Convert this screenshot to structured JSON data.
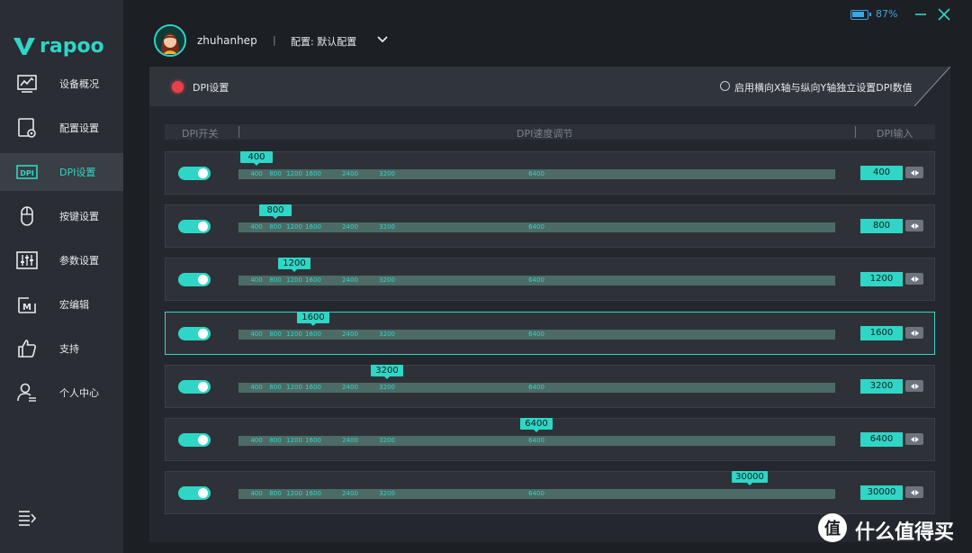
{
  "brand": {
    "logo_text": "rapoo",
    "logo_color": "#2fd6c6"
  },
  "sidebar": {
    "items": [
      {
        "label": "设备概况",
        "icon": "monitor-chart-icon",
        "active": false
      },
      {
        "label": "配置设置",
        "icon": "config-settings-icon",
        "active": false
      },
      {
        "label": "DPI设置",
        "icon": "dpi-icon",
        "active": true
      },
      {
        "label": "按键设置",
        "icon": "mouse-icon",
        "active": false
      },
      {
        "label": "参数设置",
        "icon": "sliders-icon",
        "active": false
      },
      {
        "label": "宏编辑",
        "icon": "macro-icon",
        "active": false
      },
      {
        "label": "支持",
        "icon": "thumbs-up-icon",
        "active": false
      },
      {
        "label": "个人中心",
        "icon": "user-icon",
        "active": false
      }
    ]
  },
  "topbar": {
    "username": "zhuhanhep",
    "separator": "|",
    "config_label": "配置: 默认配置",
    "battery_percent": 87,
    "battery_text": "87%"
  },
  "panel": {
    "title": "DPI设置",
    "xy_option_label": "启用横向X轴与纵向Y轴独立设置DPI数值",
    "xy_option_checked": false,
    "columns": {
      "switch": "DPI开关",
      "speed": "DPI速度调节",
      "input": "DPI输入"
    },
    "scale_ticks": [
      "400",
      "800",
      "1200",
      "1600",
      "2400",
      "3200",
      "6400"
    ],
    "rows": [
      {
        "enabled": true,
        "value": "400",
        "selected": false
      },
      {
        "enabled": true,
        "value": "800",
        "selected": false
      },
      {
        "enabled": true,
        "value": "1200",
        "selected": false
      },
      {
        "enabled": true,
        "value": "1600",
        "selected": true
      },
      {
        "enabled": true,
        "value": "3200",
        "selected": false
      },
      {
        "enabled": true,
        "value": "6400",
        "selected": false
      },
      {
        "enabled": true,
        "value": "30000",
        "selected": false
      }
    ]
  },
  "watermark": {
    "text": "什么值得买",
    "icon": "zhi-logo-icon"
  },
  "colors": {
    "accent": "#2fd6c6",
    "indicator_red": "#e8404a",
    "battery_blue": "#3aa7e0"
  }
}
